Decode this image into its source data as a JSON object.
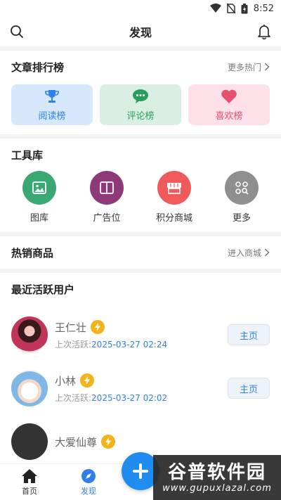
{
  "statusbar": {
    "time": "8:52",
    "icons": [
      "wifi-icon",
      "no-sim-icon",
      "battery-icon"
    ]
  },
  "appbar": {
    "title": "发现",
    "left_icon": "search-icon",
    "right_icon": "bell-icon"
  },
  "rankings": {
    "title": "文章排行榜",
    "more": "更多热门",
    "cards": [
      {
        "label": "阅读榜",
        "icon": "trophy-icon",
        "color": "#2f80ed"
      },
      {
        "label": "评论榜",
        "icon": "comment-icon",
        "color": "#2a9d5c"
      },
      {
        "label": "喜欢榜",
        "icon": "heart-icon",
        "color": "#e8506f"
      }
    ]
  },
  "tools": {
    "title": "工具库",
    "items": [
      {
        "label": "图库",
        "icon": "image-icon",
        "color": "#3aa872"
      },
      {
        "label": "广告位",
        "icon": "book-icon",
        "color": "#8e3a78"
      },
      {
        "label": "积分商城",
        "icon": "store-icon",
        "color": "#f05a5a"
      },
      {
        "label": "更多",
        "icon": "grid-search-icon",
        "color": "#8f8f8f"
      }
    ]
  },
  "hot_products": {
    "title": "热销商品",
    "more": "进入商城"
  },
  "active_users": {
    "title": "最近活跃用户",
    "time_prefix": "上次活跃:",
    "button_label": "主页",
    "users": [
      {
        "name": "王仁壮",
        "last_active": "2025-03-27 02:24"
      },
      {
        "name": "小林",
        "last_active": "2025-03-27 02:02"
      },
      {
        "name": "大爱仙尊",
        "last_active": ""
      }
    ]
  },
  "tabbar": {
    "tabs": [
      {
        "label": "首页",
        "icon": "home-icon"
      },
      {
        "label": "发现",
        "icon": "compass-icon",
        "active": true
      }
    ],
    "fab_icon": "plus-icon"
  },
  "watermark": {
    "title": "谷普软件园",
    "url": "www.gupuxlazal.com"
  }
}
